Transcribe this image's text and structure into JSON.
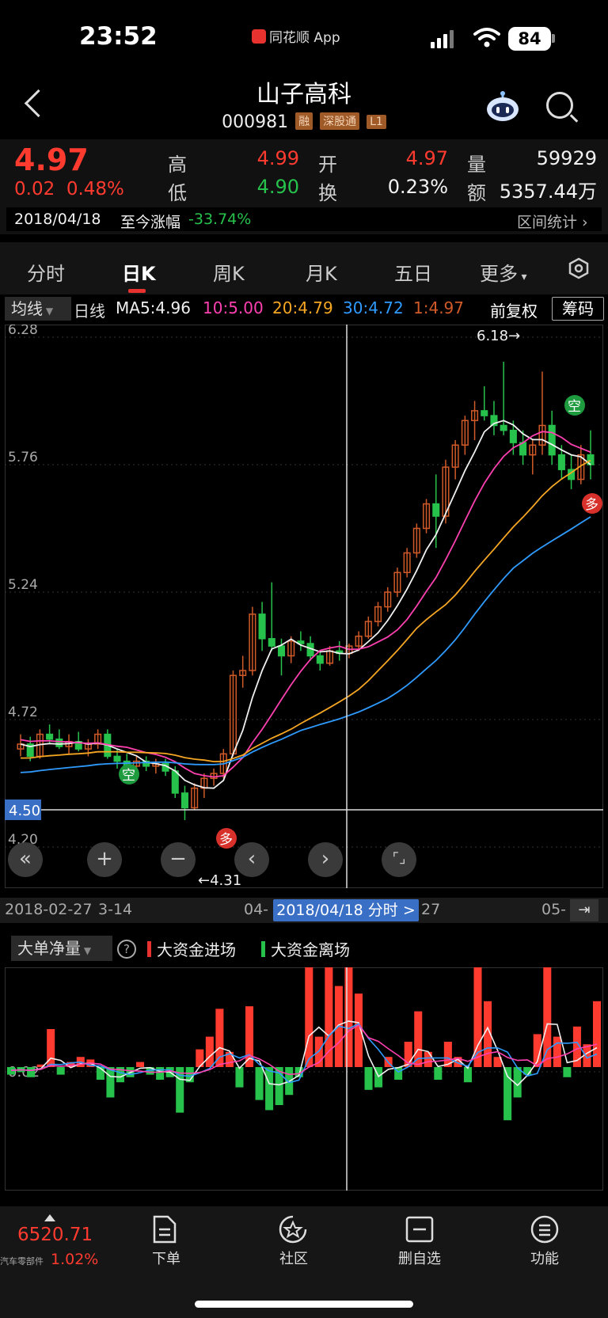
{
  "status": {
    "time": "23:52",
    "app_name": "同花顺 App",
    "battery": "84"
  },
  "header": {
    "stock_name": "山子高科",
    "stock_code": "000981",
    "tags": [
      "融",
      "深股通",
      "L1"
    ]
  },
  "quote": {
    "price": "4.97",
    "change": "0.02",
    "change_pct": "0.48%",
    "high_label": "高",
    "high": "4.99",
    "low_label": "低",
    "low": "4.90",
    "open_label": "开",
    "open": "4.97",
    "turnover_label": "换",
    "turnover": "0.23%",
    "volume_label": "量",
    "volume": "59929",
    "amount_label": "额",
    "amount": "5357.44万",
    "date": "2018/04/18",
    "ytd_label": "至今涨幅",
    "ytd": "-33.74%",
    "range_stats": "区间统计"
  },
  "tabs": [
    {
      "label": "分时"
    },
    {
      "label": "日K",
      "active": true
    },
    {
      "label": "周K"
    },
    {
      "label": "月K"
    },
    {
      "label": "五日"
    },
    {
      "label": "更多"
    }
  ],
  "ma_row": {
    "selector": "均线",
    "period": "日线",
    "ma5": "MA5:4.96",
    "ma10": "10:5.00",
    "ma20": "20:4.79",
    "ma30": "30:4.72",
    "ma1": "1:4.97",
    "adjust": "前复权",
    "chip": "筹码"
  },
  "colors": {
    "up": "#ff3b30",
    "down": "#27c24c",
    "ma5": "#f0f0f0",
    "ma10": "#ff40b0",
    "ma20": "#f5a623",
    "ma30": "#2f9bff",
    "ma1": "#d05a28"
  },
  "chart": {
    "y_labels": [
      "6.28",
      "5.76",
      "5.24",
      "4.72",
      "4.20"
    ],
    "crosshair_price": "4.50",
    "max_label": "6.18→",
    "min_label": "←4.31",
    "signal_short": "空",
    "signal_long": "多",
    "controls": [
      "«",
      "+",
      "−",
      "‹",
      "›",
      "⌜⌟"
    ]
  },
  "time_axis": {
    "labels": [
      "2018-02-27",
      "3-14",
      "04-",
      "27",
      "05-"
    ],
    "selected": "2018/04/18 分时 >"
  },
  "indicator": {
    "selector": "大单净量",
    "in_label": "大资金进场",
    "out_label": "大资金离场",
    "y_label": "0.02"
  },
  "chart_data": {
    "type": "candlestick",
    "ylim": [
      4.2,
      6.28
    ],
    "max": 6.18,
    "min": 4.31,
    "candles": [
      [
        4.6,
        4.66,
        4.57,
        4.62
      ],
      [
        4.62,
        4.65,
        4.55,
        4.57
      ],
      [
        4.57,
        4.68,
        4.56,
        4.66
      ],
      [
        4.66,
        4.7,
        4.62,
        4.64
      ],
      [
        4.64,
        4.68,
        4.6,
        4.61
      ],
      [
        4.61,
        4.66,
        4.58,
        4.63
      ],
      [
        4.63,
        4.67,
        4.59,
        4.6
      ],
      [
        4.6,
        4.64,
        4.57,
        4.62
      ],
      [
        4.62,
        4.68,
        4.6,
        4.66
      ],
      [
        4.66,
        4.68,
        4.56,
        4.57
      ],
      [
        4.57,
        4.6,
        4.52,
        4.55
      ],
      [
        4.55,
        4.58,
        4.5,
        4.53
      ],
      [
        4.53,
        4.57,
        4.5,
        4.55
      ],
      [
        4.55,
        4.57,
        4.51,
        4.53
      ],
      [
        4.53,
        4.56,
        4.5,
        4.54
      ],
      [
        4.54,
        4.56,
        4.49,
        4.51
      ],
      [
        4.51,
        4.53,
        4.4,
        4.42
      ],
      [
        4.42,
        4.45,
        4.31,
        4.36
      ],
      [
        4.36,
        4.46,
        4.35,
        4.44
      ],
      [
        4.44,
        4.5,
        4.4,
        4.48
      ],
      [
        4.48,
        4.52,
        4.45,
        4.5
      ],
      [
        4.5,
        4.6,
        4.48,
        4.58
      ],
      [
        4.58,
        4.92,
        4.57,
        4.9
      ],
      [
        4.9,
        4.98,
        4.85,
        4.92
      ],
      [
        4.92,
        5.18,
        4.9,
        5.15
      ],
      [
        5.15,
        5.2,
        5.0,
        5.05
      ],
      [
        5.05,
        5.28,
        5.0,
        5.02
      ],
      [
        5.02,
        5.05,
        4.9,
        4.98
      ],
      [
        4.98,
        5.06,
        4.95,
        5.04
      ],
      [
        5.04,
        5.08,
        5.0,
        5.03
      ],
      [
        5.03,
        5.06,
        4.96,
        4.98
      ],
      [
        4.98,
        5.0,
        4.92,
        4.95
      ],
      [
        4.95,
        5.02,
        4.94,
        5.0
      ],
      [
        5.0,
        5.04,
        4.96,
        4.99
      ],
      [
        4.99,
        5.03,
        4.97,
        5.02
      ],
      [
        5.02,
        5.08,
        5.0,
        5.06
      ],
      [
        5.06,
        5.14,
        5.05,
        5.12
      ],
      [
        5.12,
        5.2,
        5.1,
        5.18
      ],
      [
        5.18,
        5.26,
        5.16,
        5.24
      ],
      [
        5.24,
        5.34,
        5.22,
        5.32
      ],
      [
        5.32,
        5.42,
        5.3,
        5.4
      ],
      [
        5.4,
        5.52,
        5.38,
        5.5
      ],
      [
        5.5,
        5.62,
        5.48,
        5.6
      ],
      [
        5.6,
        5.72,
        5.42,
        5.55
      ],
      [
        5.55,
        5.78,
        5.52,
        5.75
      ],
      [
        5.75,
        5.86,
        5.7,
        5.84
      ],
      [
        5.84,
        5.96,
        5.8,
        5.94
      ],
      [
        5.94,
        6.02,
        5.86,
        5.98
      ],
      [
        5.98,
        6.08,
        5.94,
        5.96
      ],
      [
        5.96,
        6.02,
        5.88,
        5.92
      ],
      [
        5.92,
        6.18,
        5.88,
        5.9
      ],
      [
        5.9,
        5.94,
        5.8,
        5.85
      ],
      [
        5.85,
        5.9,
        5.76,
        5.8
      ],
      [
        5.8,
        5.86,
        5.72,
        5.84
      ],
      [
        5.84,
        6.14,
        5.8,
        5.92
      ],
      [
        5.92,
        5.98,
        5.76,
        5.8
      ],
      [
        5.8,
        5.84,
        5.7,
        5.74
      ],
      [
        5.74,
        5.8,
        5.66,
        5.7
      ],
      [
        5.7,
        5.84,
        5.68,
        5.8
      ],
      [
        5.8,
        5.9,
        5.7,
        5.76
      ]
    ],
    "indicator_values": [
      -0.3,
      -0.2,
      -0.4,
      0.1,
      1.5,
      -0.3,
      0.2,
      0.4,
      0.3,
      -0.5,
      -1.2,
      -0.6,
      -0.4,
      0.2,
      -0.3,
      -0.5,
      -0.4,
      -1.8,
      -0.6,
      0.7,
      1.2,
      2.3,
      0.6,
      -0.8,
      2.4,
      -1.3,
      -1.7,
      -1.5,
      -1.1,
      -0.4,
      6.0,
      1.2,
      4.4,
      3.2,
      5.1,
      2.9,
      -0.9,
      -0.8,
      0.4,
      -0.5,
      1.0,
      2.2,
      0.6,
      -0.5,
      1.0,
      0.4,
      -0.6,
      4.5,
      2.6,
      0.4,
      -2.1,
      -1.2,
      -0.3,
      1.3,
      6.5,
      1.2,
      -0.4,
      1.6,
      0.9,
      2.6
    ]
  }
}
